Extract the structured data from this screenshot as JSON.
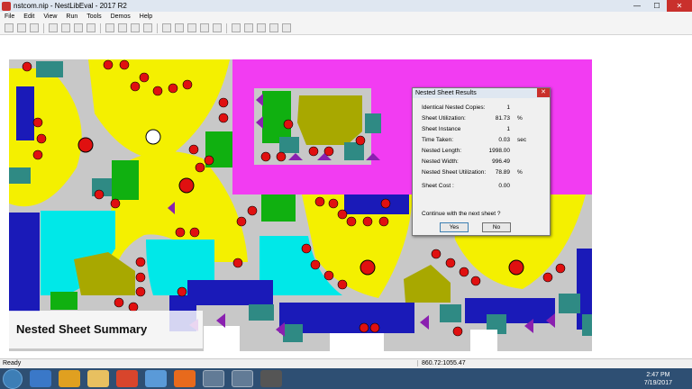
{
  "window": {
    "title": "nstcom.nip - NestLibEval - 2017 R2",
    "min_glyph": "—",
    "max_glyph": "☐",
    "close_glyph": "✕"
  },
  "menu": [
    "File",
    "Edit",
    "View",
    "Run",
    "Tools",
    "Demos",
    "Help"
  ],
  "dialog": {
    "title": "Nested Sheet Results",
    "close_glyph": "✕",
    "rows": [
      {
        "label": "Identical Nested Copies:",
        "value": "1",
        "unit": ""
      },
      {
        "label": "Sheet Utilization:",
        "value": "81.73",
        "unit": "%"
      },
      {
        "label": "Sheet Instance",
        "value": "1",
        "unit": ""
      },
      {
        "label": "Time Taken:",
        "value": "0.03",
        "unit": "sec"
      },
      {
        "label": "Nested Length:",
        "value": "1998.00",
        "unit": ""
      },
      {
        "label": "Nested Width:",
        "value": "996.49",
        "unit": ""
      },
      {
        "label": "Nested Sheet Utilization:",
        "value": "78.89",
        "unit": "%"
      },
      {
        "label": "Sheet Cost :",
        "value": "0.00",
        "unit": ""
      }
    ],
    "question": "Continue with the next sheet  ?",
    "yes_label": "Yes",
    "no_label": "No"
  },
  "caption": "Nested Sheet Summary",
  "status": {
    "left": "Ready",
    "coords": "860.72:1055.47"
  },
  "taskbar": {
    "time": "2:47 PM",
    "date": "7/19/2017"
  },
  "colors": {
    "sheet_gray": "#c8c8c8",
    "yellow": "#f4f000",
    "magenta": "#f23cf2",
    "cyan": "#00e8e8",
    "navy": "#1a1ab8",
    "teal": "#2f8a84",
    "green": "#10b010",
    "olive": "#a8a800",
    "red": "#e01010",
    "purple": "#8a20b0"
  }
}
